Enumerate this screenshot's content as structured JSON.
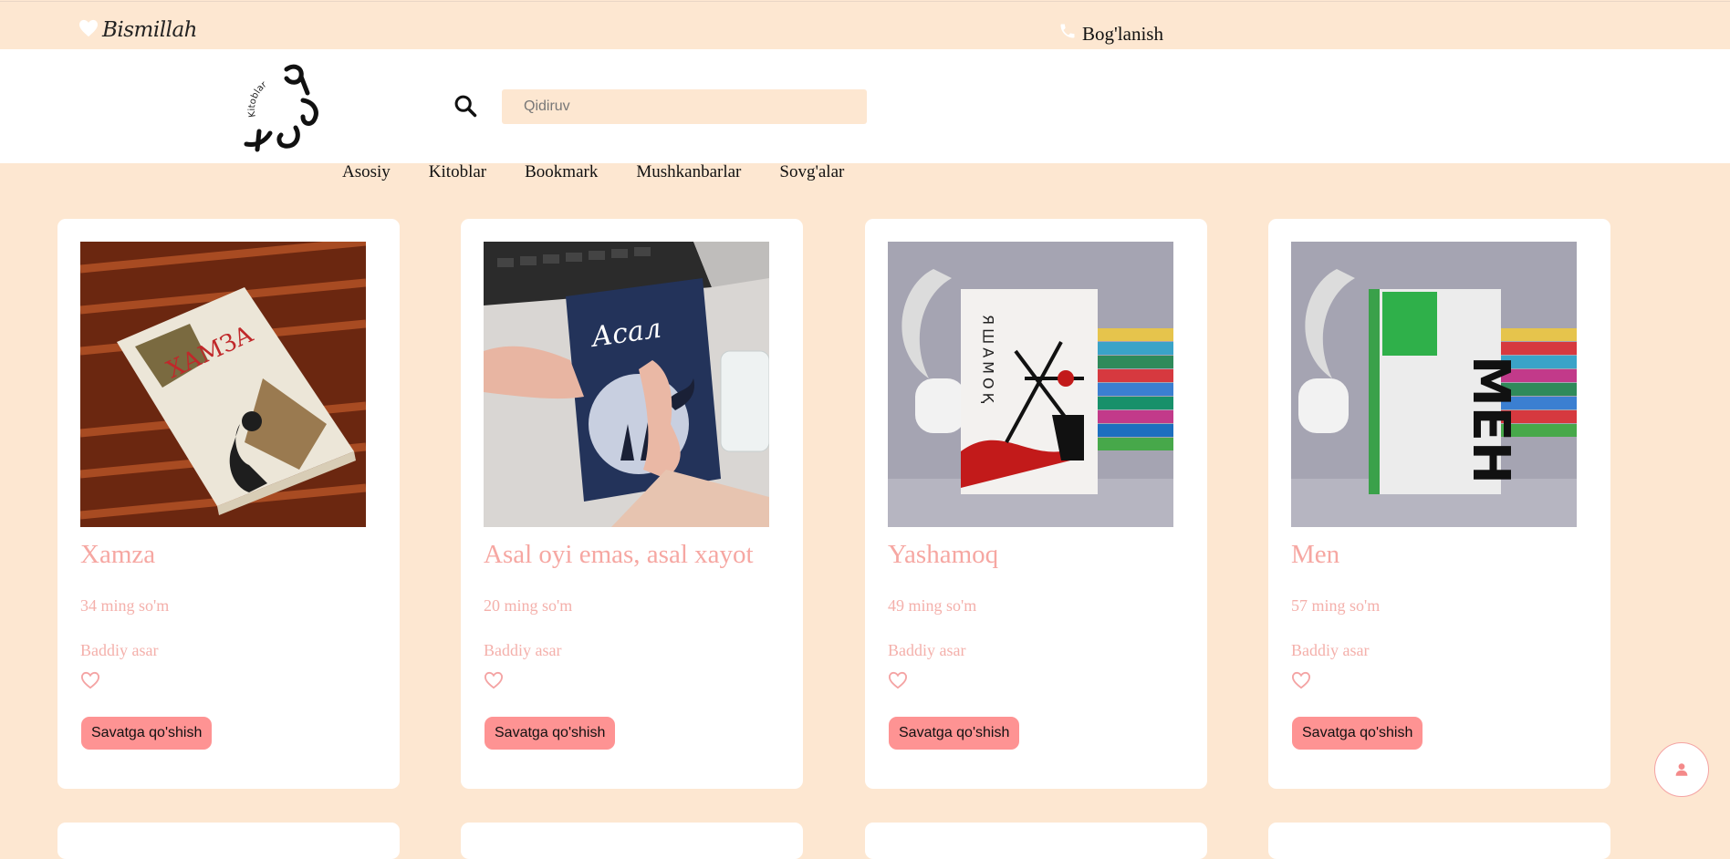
{
  "topbar": {
    "brand_text": "Bismillah",
    "brand_icon": "heart-icon",
    "contact_label": "Bog'lanish",
    "contact_icon": "phone-icon"
  },
  "header": {
    "logo_text": "Kitoblar",
    "search_icon": "search-icon",
    "search_placeholder": "Qidiruv"
  },
  "nav": [
    {
      "label": "Asosiy"
    },
    {
      "label": "Kitoblar"
    },
    {
      "label": "Bookmark"
    },
    {
      "label": "Mushkanbarlar"
    },
    {
      "label": "Sovg'alar"
    }
  ],
  "products": [
    {
      "title": "Xamza",
      "price": "34 ming so'm",
      "genre": "Baddiy asar",
      "cart_label": "Savatga qo'shish",
      "cover_text": "ХАМЗА"
    },
    {
      "title": "Asal oyi emas, asal xayot",
      "price": "20 ming so'm",
      "genre": "Baddiy asar",
      "cart_label": "Savatga qo'shish",
      "cover_text": "Асал"
    },
    {
      "title": "Yashamoq",
      "price": "49 ming so'm",
      "genre": "Baddiy asar",
      "cart_label": "Savatga qo'shish",
      "cover_text": "ЯШАМОҚ"
    },
    {
      "title": "Men",
      "price": "57 ming so'm",
      "genre": "Baddiy asar",
      "cart_label": "Savatga qo'shish",
      "cover_text": "МЕН"
    }
  ],
  "fab_icon": "user-icon",
  "colors": {
    "page_bg": "#fde7d1",
    "accent_text": "#f6a7a2",
    "cart_button": "#fe9393"
  }
}
